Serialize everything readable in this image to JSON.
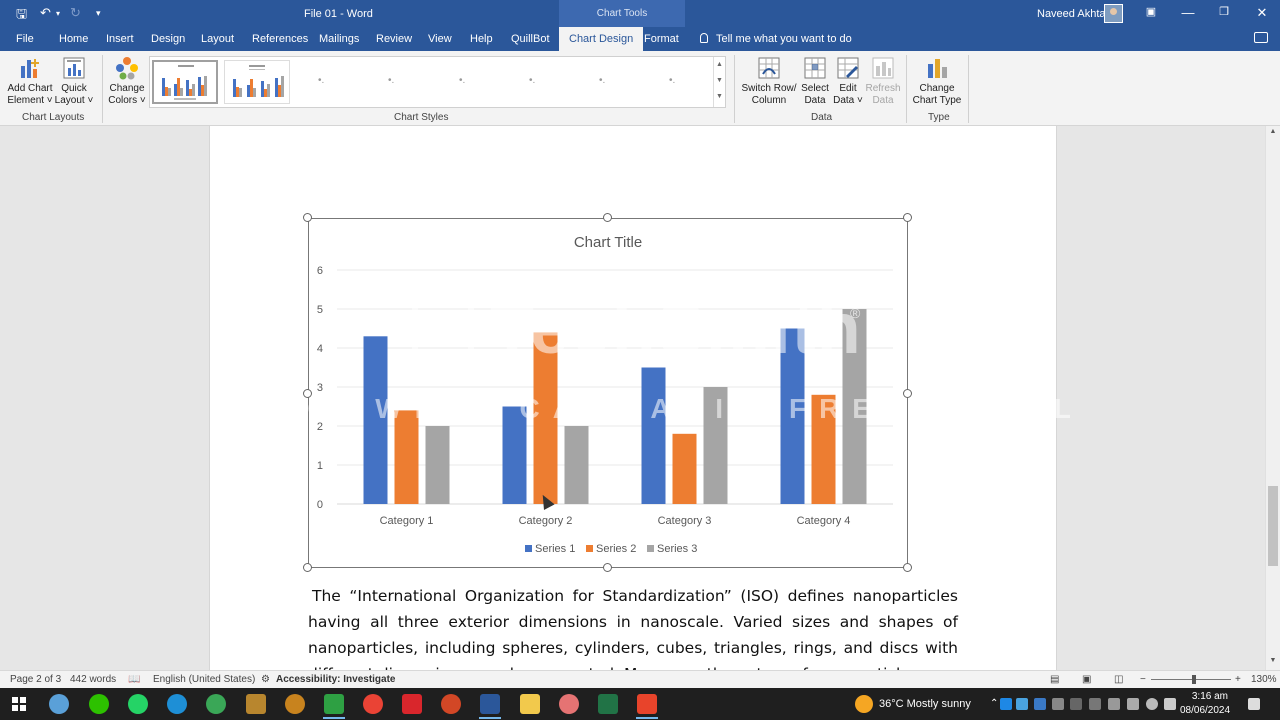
{
  "window": {
    "doc_title": "File 01  -  Word",
    "context_tab_header": "Chart Tools",
    "user_name": "Naveed Akhtar"
  },
  "tabs": [
    "File",
    "Home",
    "Insert",
    "Design",
    "Layout",
    "References",
    "Mailings",
    "Review",
    "View",
    "Help",
    "QuillBot",
    "Chart Design",
    "Format"
  ],
  "active_tab": "Chart Design",
  "tell_me": "Tell me what you want to do",
  "ribbon": {
    "add_chart_element": [
      "Add Chart",
      "Element ˅"
    ],
    "quick_layout": [
      "Quick",
      "Layout ˅"
    ],
    "change_colors": [
      "Change",
      "Colors ˅"
    ],
    "switch_row_column": [
      "Switch Row/",
      "Column"
    ],
    "select_data": [
      "Select",
      "Data"
    ],
    "edit_data": [
      "Edit",
      "Data ˅"
    ],
    "refresh_data": [
      "Refresh",
      "Data"
    ],
    "change_chart_type": [
      "Change",
      "Chart Type"
    ],
    "groups": {
      "chart_layouts": "Chart Layouts",
      "chart_styles": "Chart Styles",
      "data": "Data",
      "type": "Type"
    }
  },
  "colors": {
    "series1": "#4472c4",
    "series2": "#ed7d31",
    "series3": "#a5a5a5",
    "word_blue": "#2b579a"
  },
  "chart_data": {
    "type": "bar",
    "title": "Chart Title",
    "categories": [
      "Category 1",
      "Category 2",
      "Category 3",
      "Category 4"
    ],
    "series": [
      {
        "name": "Series 1",
        "values": [
          4.3,
          2.5,
          3.5,
          4.5
        ]
      },
      {
        "name": "Series 2",
        "values": [
          2.4,
          4.4,
          1.8,
          2.8
        ]
      },
      {
        "name": "Series 3",
        "values": [
          2,
          2,
          3,
          5
        ]
      }
    ],
    "ylim": [
      0,
      6
    ],
    "yticks": [
      "0",
      "1",
      "2",
      "3",
      "4",
      "5",
      "6"
    ],
    "grid": true,
    "legend": "bottom"
  },
  "watermark": {
    "brand": "TechSmith",
    "strip": "MADE WITH CAMTASIA FREE TRIAL",
    "registered": "®"
  },
  "body_text": "The “International Organization for Standardization” (ISO) defines nanoparticles having all three exterior dimensions in nanoscale. Varied sizes and shapes of nanoparticles, including spheres, cylinders, cubes, triangles, rings, and discs with different dimensions, can be generated. Moreover, the nature of nanoparticles",
  "status": {
    "page": "Page 2 of 3",
    "words": "442 words",
    "language": "English (United States)",
    "accessibility": "Accessibility: Investigate",
    "zoom": "130%"
  },
  "taskbar": {
    "weather": "36°C  Mostly sunny",
    "time": "3:16 am",
    "date": "08/06/2024"
  }
}
